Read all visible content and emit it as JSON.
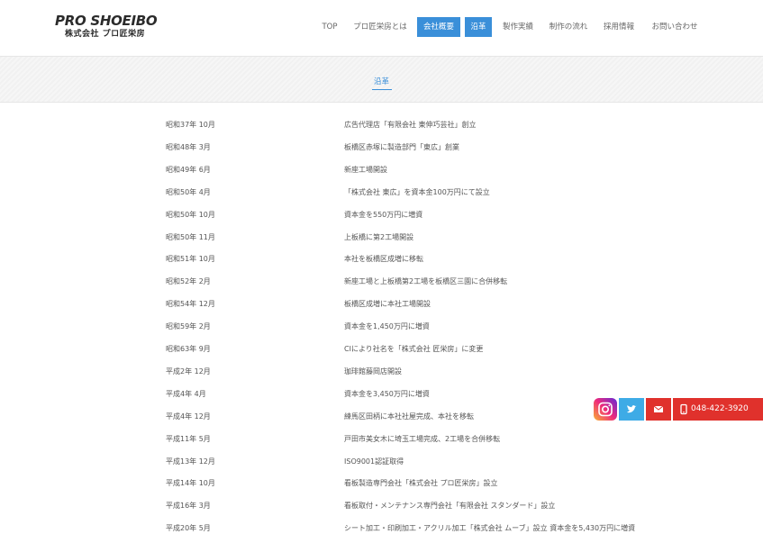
{
  "header": {
    "logo_main": "PRO SHOEIBO",
    "logo_sub": "株式会社 プロ匠栄房"
  },
  "nav": {
    "items": [
      {
        "label": "TOP",
        "active": false
      },
      {
        "label": "プロ匠栄房とは",
        "active": false
      },
      {
        "label": "会社概要",
        "active": true
      },
      {
        "label": "沿革",
        "active": true
      },
      {
        "label": "製作実績",
        "active": false
      },
      {
        "label": "制作の流れ",
        "active": false
      },
      {
        "label": "採用情報",
        "active": false
      },
      {
        "label": "お問い合わせ",
        "active": false
      }
    ]
  },
  "page_title": "沿革",
  "history": [
    {
      "date": "昭和37年 10月",
      "event": "広告代理店「有限会社 東伸巧芸社」創立"
    },
    {
      "date": "昭和48年 3月",
      "event": "板橋区赤塚に製造部門「東広」創業"
    },
    {
      "date": "昭和49年 6月",
      "event": "新座工場開設"
    },
    {
      "date": "昭和50年 4月",
      "event": "「株式会社 東広」を資本金100万円にて設立"
    },
    {
      "date": "昭和50年 10月",
      "event": "資本金を550万円に増資"
    },
    {
      "date": "昭和50年 11月",
      "event": "上板橋に第2工場開設"
    },
    {
      "date": "昭和51年 10月",
      "event": "本社を板橋区成増に移転"
    },
    {
      "date": "昭和52年 2月",
      "event": "新座工場と上板橋第2工場を板橋区三園に合併移転"
    },
    {
      "date": "昭和54年 12月",
      "event": "板橋区成増に本社工場開設"
    },
    {
      "date": "昭和59年 2月",
      "event": "資本金を1,450万円に増資"
    },
    {
      "date": "昭和63年 9月",
      "event": "CIにより社名を「株式会社 匠栄房」に変更"
    },
    {
      "date": "平成2年 12月",
      "event": "珈琲館藤岡店開設"
    },
    {
      "date": "平成4年 4月",
      "event": "資本金を3,450万円に増資"
    },
    {
      "date": "平成4年 12月",
      "event": "練馬区田柄に本社社屋完成、本社を移転"
    },
    {
      "date": "平成11年 5月",
      "event": "戸田市美女木に埼玉工場完成、2工場を合併移転"
    },
    {
      "date": "平成13年 12月",
      "event": "ISO9001認証取得"
    },
    {
      "date": "平成14年 10月",
      "event": "看板製造専門会社「株式会社 プロ匠栄房」設立"
    },
    {
      "date": "平成16年 3月",
      "event": "看板取付・メンテナンス専門会社「有限会社 スタンダード」設立"
    },
    {
      "date": "平成20年 5月",
      "event": "シート加工・印刷加工・アクリル加工「株式会社 ムーブ」設立 資本金を5,430万円に増資"
    }
  ],
  "floating": {
    "icons": {
      "instagram": "instagram-icon",
      "twitter": "twitter-icon",
      "mail": "mail-icon",
      "phone": "phone-icon"
    },
    "phone": "048-422-3920"
  },
  "colors": {
    "accent": "#3a8fd9",
    "red": "#e0312c",
    "twitter": "#3eabe6"
  }
}
